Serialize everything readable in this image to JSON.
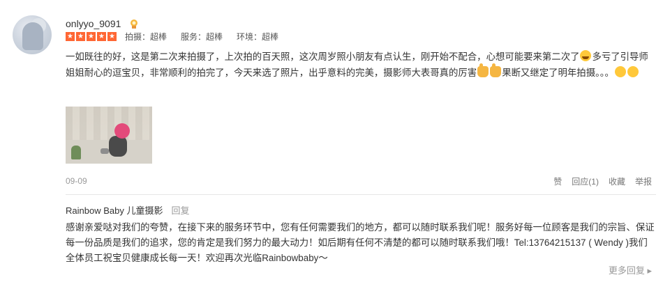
{
  "user": {
    "name": "onlyyo_9091"
  },
  "rating": {
    "stars": 5,
    "scores": [
      {
        "label": "拍摄：超棒"
      },
      {
        "label": "服务：超棒"
      },
      {
        "label": "环境：超棒"
      }
    ]
  },
  "review": {
    "part1": "一如既往的好，这是第二次来拍摄了，上次拍的百天照，这次周岁照小朋友有点认生，刚开始不配合，心想可能要来第二次了",
    "part2": "多亏了引导师姐姐耐心的逗宝贝，非常顺利的拍完了，今天来选了照片，出乎意料的完美，摄影师大表哥真的厉害",
    "part3": "果断又继定了明年拍摄。。。",
    "emoji_names": [
      "laugh-emoji",
      "thumbs-up-emoji",
      "thumbs-up-emoji",
      "face-emoji",
      "face-emoji"
    ]
  },
  "meta": {
    "date": "09-09",
    "actions": {
      "like": "赞",
      "reply": "回应(1)",
      "favorite": "收藏",
      "report": "举报"
    }
  },
  "merchant_reply": {
    "name": "Rainbow Baby 儿童摄影",
    "tag": "回复",
    "text": "感谢亲爱哒对我们的夸赞，在接下来的服务环节中，您有任何需要我们的地方，都可以随时联系我们呢！服务好每一位顾客是我们的宗旨、保证每一份品质是我们的追求，您的肯定是我们努力的最大动力！如后期有任何不清楚的都可以随时联系我们哦！Tel:13764215137 ( Wendy )我们全体员工祝宝贝健康成长每一天！欢迎再次光临Rainbowbaby～",
    "more": "更多回复 ▸"
  },
  "colors": {
    "star": "#ff6633",
    "muted": "#999999",
    "text": "#333333"
  }
}
